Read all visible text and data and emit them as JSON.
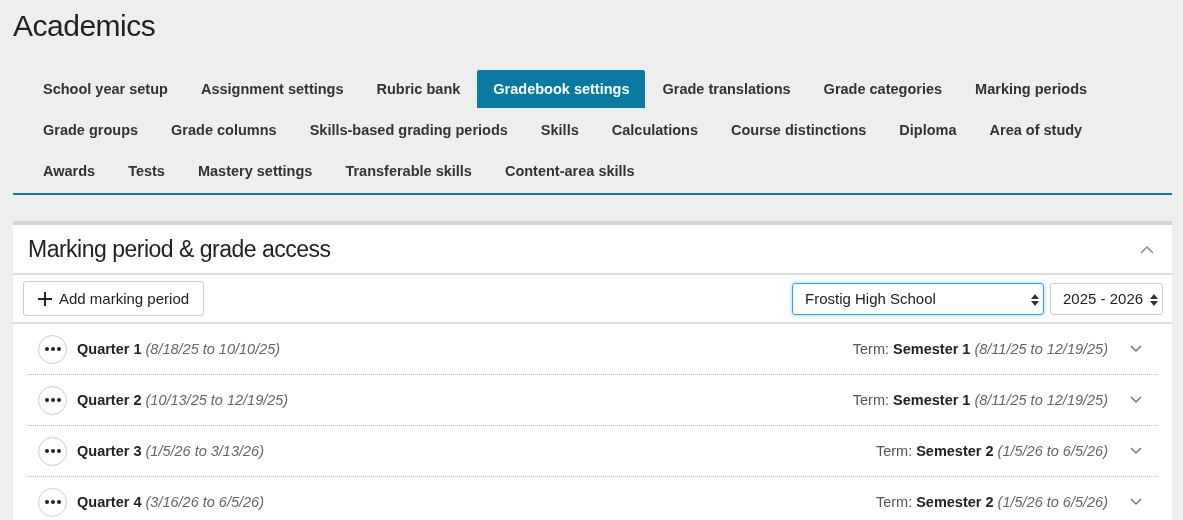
{
  "page_title": "Academics",
  "tabs": [
    {
      "label": "School year setup",
      "selected": false
    },
    {
      "label": "Assignment settings",
      "selected": false
    },
    {
      "label": "Rubric bank",
      "selected": false
    },
    {
      "label": "Gradebook settings",
      "selected": true
    },
    {
      "label": "Grade translations",
      "selected": false
    },
    {
      "label": "Grade categories",
      "selected": false
    },
    {
      "label": "Marking periods",
      "selected": false
    },
    {
      "label": "Grade groups",
      "selected": false
    },
    {
      "label": "Grade columns",
      "selected": false
    },
    {
      "label": "Skills-based grading periods",
      "selected": false
    },
    {
      "label": "Skills",
      "selected": false
    },
    {
      "label": "Calculations",
      "selected": false
    },
    {
      "label": "Course distinctions",
      "selected": false
    },
    {
      "label": "Diploma",
      "selected": false
    },
    {
      "label": "Area of study",
      "selected": false
    },
    {
      "label": "Awards",
      "selected": false
    },
    {
      "label": "Tests",
      "selected": false
    },
    {
      "label": "Mastery settings",
      "selected": false
    },
    {
      "label": "Transferable skills",
      "selected": false
    },
    {
      "label": "Content-area skills",
      "selected": false
    }
  ],
  "panel": {
    "title": "Marking period & grade access",
    "expanded": true,
    "add_button": "Add marking period",
    "school_select": {
      "value": "Frostig High School",
      "focused": true
    },
    "year_select": {
      "value": "2025 - 2026",
      "focused": false
    },
    "rows": [
      {
        "name": "Quarter 1",
        "dates": "(8/18/25 to 10/10/25)",
        "term_label": "Term:",
        "term": "Semester 1",
        "term_dates": "(8/11/25 to 12/19/25)",
        "expanded": false
      },
      {
        "name": "Quarter 2",
        "dates": "(10/13/25 to 12/19/25)",
        "term_label": "Term:",
        "term": "Semester 1",
        "term_dates": "(8/11/25 to 12/19/25)",
        "expanded": false
      },
      {
        "name": "Quarter 3",
        "dates": "(1/5/26 to 3/13/26)",
        "term_label": "Term:",
        "term": "Semester 2",
        "term_dates": "(1/5/26 to 6/5/26)",
        "expanded": false
      },
      {
        "name": "Quarter 4",
        "dates": "(3/16/26 to 6/5/26)",
        "term_label": "Term:",
        "term": "Semester 2",
        "term_dates": "(1/5/26 to 6/5/26)",
        "expanded": false
      }
    ]
  }
}
